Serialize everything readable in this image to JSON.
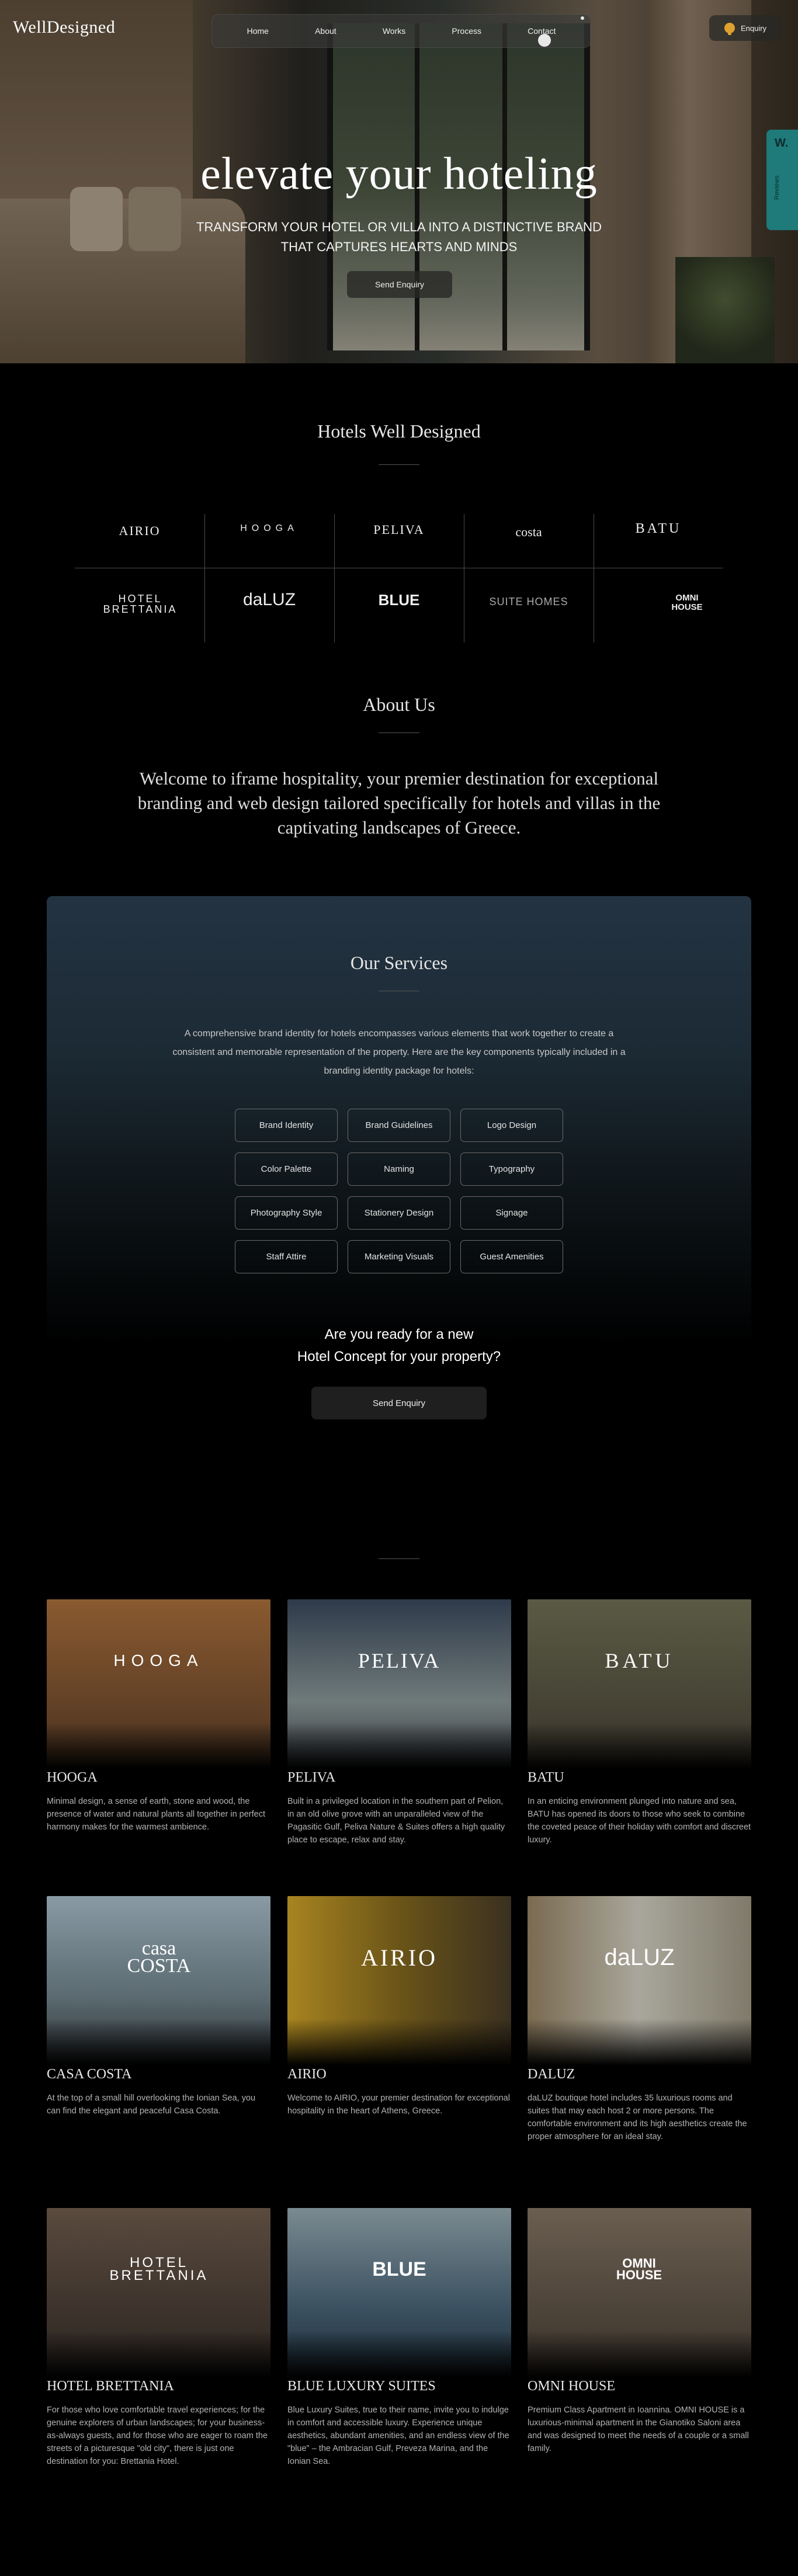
{
  "header": {
    "logo": "WellDesigned",
    "nav": [
      "Home",
      "About",
      "Works",
      "Process",
      "Contact"
    ],
    "enquiry": "Enquiry",
    "side_tab": {
      "mark": "W.",
      "label": "Reviews"
    }
  },
  "hero": {
    "title": "elevate your hoteling",
    "subtitle_line1": "TRANSFORM YOUR HOTEL OR VILLA INTO A DISTINCTIVE BRAND",
    "subtitle_line2": "THAT CAPTURES HEARTS AND MINDS",
    "button": "Send Enquiry"
  },
  "partners": {
    "title": "Hotels Well Designed",
    "logos": [
      "AIRIO",
      "HOOGA",
      "PELIVA",
      "costa",
      "BATU",
      "HOTEL BRETTANIA",
      "daLUZ",
      "BLUE",
      "SUITE HOMES",
      "OMNI HOUSE"
    ]
  },
  "about": {
    "title": "About Us",
    "text": "Welcome to iframe hospitality, your premier destination for exceptional branding and web design tailored specifically for hotels and villas in the captivating landscapes of Greece."
  },
  "services": {
    "title": "Our Services",
    "intro": "A comprehensive brand identity for hotels encompasses various elements that work together to create a consistent and memorable representation of the property. Here are the key components typically included in a branding identity package for hotels:",
    "items": [
      "Brand Identity",
      "Brand Guidelines",
      "Logo Design",
      "Color Palette",
      "Naming",
      "Typography",
      "Photography Style",
      "Stationery Design",
      "Signage",
      "Staff Attire",
      "Marketing Visuals",
      "Guest Amenities"
    ],
    "question_line1": "Are you ready for a new",
    "question_line2": "Hotel Concept for your property?",
    "button": "Send Enquiry"
  },
  "projects": [
    {
      "brand": "HOOGA",
      "title": "HOOGA",
      "text": "Minimal design, a sense of earth, stone and wood, the presence of water and natural plants all together in perfect harmony makes for the warmest ambience.",
      "bg": "#6e4a2c"
    },
    {
      "brand": "PELIVA",
      "title": "PELIVA",
      "text": "Built in a privileged location in the southern part of Pelion, in an old olive grove with an unparalleled view of the Pagasitic Gulf, Peliva Nature & Suites offers a high quality place to escape, relax and stay.",
      "bg": "#3f4a55"
    },
    {
      "brand": "BATU",
      "title": "BATU",
      "text": "In an enticing environment plunged into nature and sea, BATU has opened its doors to those who seek to combine the coveted peace of their holiday with comfort and discreet luxury.",
      "bg": "#4b4a3e"
    },
    {
      "brand": "casa COSTA",
      "title": "CASA COSTA",
      "text": "At the top of a small hill overlooking the Ionian Sea, you can find the elegant and peaceful Casa Costa.",
      "bg": "#6a7c88"
    },
    {
      "brand": "AIRIO",
      "title": "AIRIO",
      "text": "Welcome to AIRIO, your premier destination for exceptional hospitality in the heart of Athens, Greece.",
      "bg": "#8a6a1c"
    },
    {
      "brand": "daLUZ",
      "title": "DALUZ",
      "text": "daLUZ boutique hotel includes 35 luxurious rooms and suites that may each host 2 or more persons. The comfortable environment and its high aesthetics create the proper atmosphere for an ideal stay.",
      "bg": "#8f8d86"
    },
    {
      "brand": "HOTEL BRETTANIA",
      "title": "HOTEL BRETTANIA",
      "text": "For those who love comfortable travel experiences; for the genuine explorers of urban landscapes; for your business-as-always guests, and for those who are eager to roam the streets of a picturesque \"old city\", there is just one destination for you: Brettania Hotel.",
      "bg": "#4b3e34"
    },
    {
      "brand": "BLUE",
      "title": "BLUE LUXURY SUITES",
      "text": "Blue Luxury Suites, true to their name, invite you to indulge in comfort and accessible luxury. Experience unique aesthetics, abundant amenities, and an endless view of the \"blue\" – the Ambracian Gulf, Preveza Marina, and the Ionian Sea.",
      "bg": "#3b5364"
    },
    {
      "brand": "OMNI HOUSE",
      "title": "OMNI HOUSE",
      "text": "Premium Class Apartment in Ioannina. OMNI HOUSE is a luxurious-minimal apartment in the Gianotiko Saloni area and was designed to meet the needs of a couple or a small family.",
      "bg": "#5a5248"
    }
  ]
}
